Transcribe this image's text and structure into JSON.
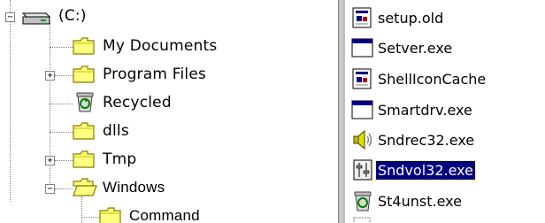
{
  "tree": {
    "root": {
      "label": "(C:)",
      "expander": "−"
    },
    "items": [
      {
        "label": "My Documents",
        "expander": null
      },
      {
        "label": "Program Files",
        "expander": "+"
      },
      {
        "label": "Recycled",
        "expander": null
      },
      {
        "label": "dlls",
        "expander": null
      },
      {
        "label": "Tmp",
        "expander": "+"
      },
      {
        "label": "Windows",
        "expander": "−"
      },
      {
        "label": "Command",
        "expander": null
      }
    ]
  },
  "files": [
    {
      "label": "setup.old",
      "icon": "document-icon",
      "selected": false
    },
    {
      "label": "Setver.exe",
      "icon": "window-app-icon",
      "selected": false
    },
    {
      "label": "ShellIconCache",
      "icon": "document-icon",
      "selected": false
    },
    {
      "label": "Smartdrv.exe",
      "icon": "window-app-icon",
      "selected": false
    },
    {
      "label": "Sndrec32.exe",
      "icon": "speaker-icon",
      "selected": false
    },
    {
      "label": "Sndvol32.exe",
      "icon": "volume-control-icon",
      "selected": true
    },
    {
      "label": "St4unst.exe",
      "icon": "uninstall-trash-icon",
      "selected": false
    }
  ],
  "colors": {
    "selection": "#000080",
    "folder": "#ffff80",
    "folder_edge": "#808000",
    "splitter": "#c0c0c0"
  }
}
